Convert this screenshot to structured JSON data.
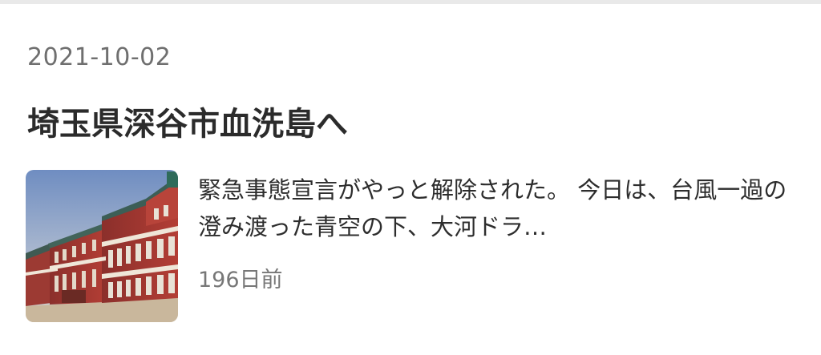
{
  "entry": {
    "date": "2021-10-02",
    "title": "埼玉県深谷市血洗島へ",
    "excerpt": "緊急事態宣言がやっと解除された。 今日は、台風一過の澄み渡った青空の下、大河ドラ…",
    "relative_time": "196日前",
    "thumbnail_icon": "red-brick-station-photo"
  }
}
